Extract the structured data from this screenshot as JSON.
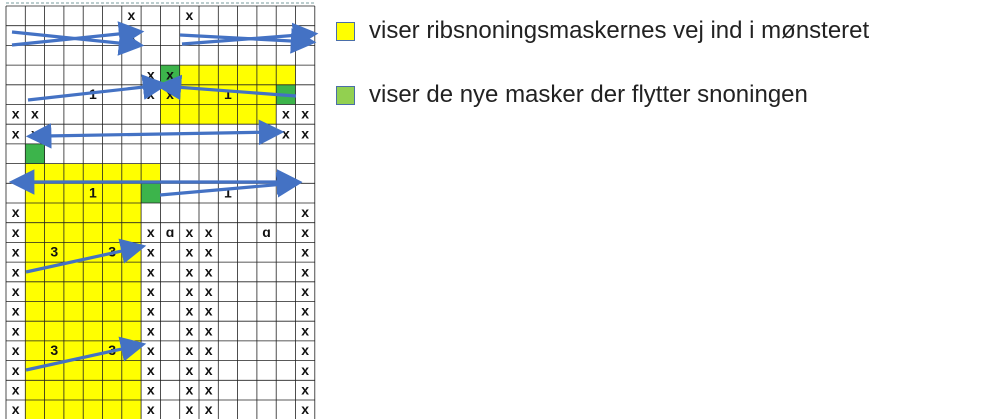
{
  "legend": [
    {
      "label": "viser ribsnoningsmaskernes vej ind i mønsteret",
      "color": "#ffff00"
    },
    {
      "label": "viser de nye masker der flytter snoningen",
      "color": "#92d050"
    }
  ],
  "grid": {
    "cols": 16,
    "rows": 21,
    "yellow_cells": [
      [
        3,
        8
      ],
      [
        3,
        9
      ],
      [
        3,
        10
      ],
      [
        3,
        11
      ],
      [
        3,
        12
      ],
      [
        3,
        13
      ],
      [
        3,
        14
      ],
      [
        4,
        8
      ],
      [
        4,
        9
      ],
      [
        4,
        10
      ],
      [
        4,
        11
      ],
      [
        4,
        12
      ],
      [
        4,
        13
      ],
      [
        5,
        8
      ],
      [
        5,
        9
      ],
      [
        5,
        10
      ],
      [
        5,
        11
      ],
      [
        5,
        12
      ],
      [
        5,
        13
      ],
      [
        8,
        1
      ],
      [
        8,
        2
      ],
      [
        8,
        3
      ],
      [
        8,
        4
      ],
      [
        8,
        5
      ],
      [
        8,
        6
      ],
      [
        8,
        7
      ],
      [
        9,
        1
      ],
      [
        9,
        2
      ],
      [
        9,
        3
      ],
      [
        9,
        4
      ],
      [
        9,
        5
      ],
      [
        9,
        6
      ],
      [
        10,
        1
      ],
      [
        10,
        2
      ],
      [
        10,
        3
      ],
      [
        10,
        4
      ],
      [
        10,
        5
      ],
      [
        10,
        6
      ],
      [
        11,
        1
      ],
      [
        11,
        2
      ],
      [
        11,
        3
      ],
      [
        11,
        4
      ],
      [
        11,
        5
      ],
      [
        11,
        6
      ],
      [
        12,
        1
      ],
      [
        12,
        2
      ],
      [
        12,
        3
      ],
      [
        12,
        4
      ],
      [
        12,
        5
      ],
      [
        12,
        6
      ],
      [
        13,
        1
      ],
      [
        13,
        2
      ],
      [
        13,
        3
      ],
      [
        13,
        4
      ],
      [
        13,
        5
      ],
      [
        13,
        6
      ],
      [
        14,
        1
      ],
      [
        14,
        2
      ],
      [
        14,
        3
      ],
      [
        14,
        4
      ],
      [
        14,
        5
      ],
      [
        14,
        6
      ],
      [
        15,
        1
      ],
      [
        15,
        2
      ],
      [
        15,
        3
      ],
      [
        15,
        4
      ],
      [
        15,
        5
      ],
      [
        15,
        6
      ],
      [
        16,
        1
      ],
      [
        16,
        2
      ],
      [
        16,
        3
      ],
      [
        16,
        4
      ],
      [
        16,
        5
      ],
      [
        16,
        6
      ],
      [
        17,
        1
      ],
      [
        17,
        2
      ],
      [
        17,
        3
      ],
      [
        17,
        4
      ],
      [
        17,
        5
      ],
      [
        17,
        6
      ],
      [
        18,
        1
      ],
      [
        18,
        2
      ],
      [
        18,
        3
      ],
      [
        18,
        4
      ],
      [
        18,
        5
      ],
      [
        18,
        6
      ],
      [
        19,
        1
      ],
      [
        19,
        2
      ],
      [
        19,
        3
      ],
      [
        19,
        4
      ],
      [
        19,
        5
      ],
      [
        19,
        6
      ],
      [
        20,
        1
      ],
      [
        20,
        2
      ],
      [
        20,
        3
      ],
      [
        20,
        4
      ],
      [
        20,
        5
      ],
      [
        20,
        6
      ]
    ],
    "green_cells": [
      [
        3,
        8
      ],
      [
        4,
        14
      ],
      [
        7,
        1
      ],
      [
        9,
        7
      ]
    ],
    "symbols": [
      {
        "row": 0,
        "col": 6,
        "text": "x"
      },
      {
        "row": 0,
        "col": 9,
        "text": "x"
      },
      {
        "row": 1,
        "col": 6,
        "text": "x"
      },
      {
        "row": 3,
        "col": 7,
        "text": "x"
      },
      {
        "row": 3,
        "col": 8,
        "text": "x"
      },
      {
        "row": 4,
        "col": 4,
        "text": "1"
      },
      {
        "row": 4,
        "col": 7,
        "text": "x"
      },
      {
        "row": 4,
        "col": 8,
        "text": "x"
      },
      {
        "row": 4,
        "col": 11,
        "text": "1"
      },
      {
        "row": 5,
        "col": 0,
        "text": "x"
      },
      {
        "row": 5,
        "col": 1,
        "text": "x"
      },
      {
        "row": 5,
        "col": 14,
        "text": "x"
      },
      {
        "row": 5,
        "col": 15,
        "text": "x"
      },
      {
        "row": 6,
        "col": 0,
        "text": "x"
      },
      {
        "row": 6,
        "col": 1,
        "text": "x"
      },
      {
        "row": 6,
        "col": 14,
        "text": "x"
      },
      {
        "row": 6,
        "col": 15,
        "text": "x"
      },
      {
        "row": 9,
        "col": 4,
        "text": "1"
      },
      {
        "row": 9,
        "col": 11,
        "text": "1"
      },
      {
        "row": 10,
        "col": 0,
        "text": "x"
      },
      {
        "row": 10,
        "col": 15,
        "text": "x"
      },
      {
        "row": 11,
        "col": 0,
        "text": "x"
      },
      {
        "row": 11,
        "col": 7,
        "text": "x"
      },
      {
        "row": 11,
        "col": 8,
        "text": "ɑ"
      },
      {
        "row": 11,
        "col": 9,
        "text": "x"
      },
      {
        "row": 11,
        "col": 10,
        "text": "x"
      },
      {
        "row": 11,
        "col": 13,
        "text": "ɑ"
      },
      {
        "row": 11,
        "col": 15,
        "text": "x"
      },
      {
        "row": 12,
        "col": 0,
        "text": "x"
      },
      {
        "row": 12,
        "col": 2,
        "text": "3"
      },
      {
        "row": 12,
        "col": 5,
        "text": "3"
      },
      {
        "row": 12,
        "col": 7,
        "text": "x"
      },
      {
        "row": 12,
        "col": 9,
        "text": "x"
      },
      {
        "row": 12,
        "col": 10,
        "text": "x"
      },
      {
        "row": 12,
        "col": 15,
        "text": "x"
      },
      {
        "row": 13,
        "col": 0,
        "text": "x"
      },
      {
        "row": 13,
        "col": 7,
        "text": "x"
      },
      {
        "row": 13,
        "col": 9,
        "text": "x"
      },
      {
        "row": 13,
        "col": 10,
        "text": "x"
      },
      {
        "row": 13,
        "col": 15,
        "text": "x"
      },
      {
        "row": 14,
        "col": 0,
        "text": "x"
      },
      {
        "row": 14,
        "col": 7,
        "text": "x"
      },
      {
        "row": 14,
        "col": 9,
        "text": "x"
      },
      {
        "row": 14,
        "col": 10,
        "text": "x"
      },
      {
        "row": 14,
        "col": 15,
        "text": "x"
      },
      {
        "row": 15,
        "col": 0,
        "text": "x"
      },
      {
        "row": 15,
        "col": 7,
        "text": "x"
      },
      {
        "row": 15,
        "col": 9,
        "text": "x"
      },
      {
        "row": 15,
        "col": 10,
        "text": "x"
      },
      {
        "row": 15,
        "col": 15,
        "text": "x"
      },
      {
        "row": 16,
        "col": 0,
        "text": "x"
      },
      {
        "row": 16,
        "col": 7,
        "text": "x"
      },
      {
        "row": 16,
        "col": 9,
        "text": "x"
      },
      {
        "row": 16,
        "col": 10,
        "text": "x"
      },
      {
        "row": 16,
        "col": 15,
        "text": "x"
      },
      {
        "row": 17,
        "col": 0,
        "text": "x"
      },
      {
        "row": 17,
        "col": 2,
        "text": "3"
      },
      {
        "row": 17,
        "col": 5,
        "text": "3"
      },
      {
        "row": 17,
        "col": 7,
        "text": "x"
      },
      {
        "row": 17,
        "col": 9,
        "text": "x"
      },
      {
        "row": 17,
        "col": 10,
        "text": "x"
      },
      {
        "row": 17,
        "col": 15,
        "text": "x"
      },
      {
        "row": 18,
        "col": 0,
        "text": "x"
      },
      {
        "row": 18,
        "col": 7,
        "text": "x"
      },
      {
        "row": 18,
        "col": 9,
        "text": "x"
      },
      {
        "row": 18,
        "col": 10,
        "text": "x"
      },
      {
        "row": 18,
        "col": 15,
        "text": "x"
      },
      {
        "row": 19,
        "col": 0,
        "text": "x"
      },
      {
        "row": 19,
        "col": 7,
        "text": "x"
      },
      {
        "row": 19,
        "col": 9,
        "text": "x"
      },
      {
        "row": 19,
        "col": 10,
        "text": "x"
      },
      {
        "row": 19,
        "col": 15,
        "text": "x"
      },
      {
        "row": 20,
        "col": 0,
        "text": "x"
      },
      {
        "row": 20,
        "col": 7,
        "text": "x"
      },
      {
        "row": 20,
        "col": 9,
        "text": "x"
      },
      {
        "row": 20,
        "col": 10,
        "text": "x"
      },
      {
        "row": 20,
        "col": 15,
        "text": "x"
      }
    ]
  },
  "arrow_color": "#4472c4"
}
